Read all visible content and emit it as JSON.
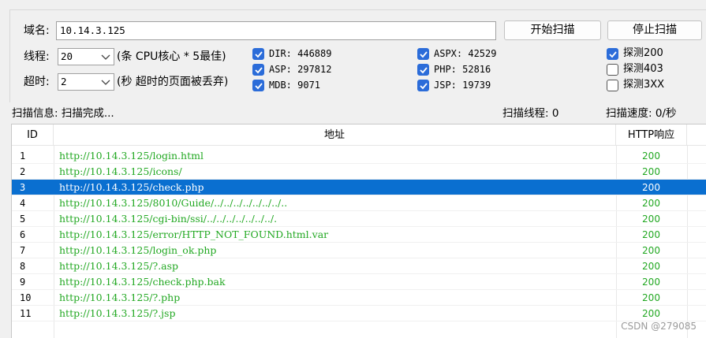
{
  "domain_field": {
    "label": "域名:",
    "value": "10.14.3.125"
  },
  "buttons": {
    "start": "开始扫描",
    "stop": "停止扫描"
  },
  "threads": {
    "label": "线程:",
    "value": "20",
    "hint": "(条 CPU核心 * 5最佳)"
  },
  "timeout": {
    "label": "超时:",
    "value": "2",
    "hint": "(秒 超时的页面被丢弃)"
  },
  "dicts": [
    {
      "label": "DIR: 446889",
      "checked": true
    },
    {
      "label": "ASP: 297812",
      "checked": true
    },
    {
      "label": "MDB: 9071",
      "checked": true
    },
    {
      "label": "ASPX: 42529",
      "checked": true
    },
    {
      "label": "PHP: 52816",
      "checked": true
    },
    {
      "label": "JSP: 19739",
      "checked": true
    }
  ],
  "probes": [
    {
      "label": "探测200",
      "checked": true
    },
    {
      "label": "探测403",
      "checked": false
    },
    {
      "label": "探测3XX",
      "checked": false
    }
  ],
  "status": {
    "info": "扫描信息: 扫描完成...",
    "threads": "扫描线程: 0",
    "speed": "扫描速度: 0/秒"
  },
  "table": {
    "headers": {
      "id": "ID",
      "address": "地址",
      "http": "HTTP响应"
    },
    "selected_index": 2,
    "rows": [
      {
        "id": "1",
        "url": "http://10.14.3.125/login.html",
        "code": "200"
      },
      {
        "id": "2",
        "url": "http://10.14.3.125/icons/",
        "code": "200"
      },
      {
        "id": "3",
        "url": "http://10.14.3.125/check.php",
        "code": "200"
      },
      {
        "id": "4",
        "url": "http://10.14.3.125/8010/Guide/../../../../../../../..",
        "code": "200"
      },
      {
        "id": "5",
        "url": "http://10.14.3.125/cgi-bin/ssi/../../../../../../../.",
        "code": "200"
      },
      {
        "id": "6",
        "url": "http://10.14.3.125/error/HTTP_NOT_FOUND.html.var",
        "code": "200"
      },
      {
        "id": "7",
        "url": "http://10.14.3.125/login_ok.php",
        "code": "200"
      },
      {
        "id": "8",
        "url": "http://10.14.3.125/?.asp",
        "code": "200"
      },
      {
        "id": "9",
        "url": "http://10.14.3.125/check.php.bak",
        "code": "200"
      },
      {
        "id": "10",
        "url": "http://10.14.3.125/?.php",
        "code": "200"
      },
      {
        "id": "11",
        "url": "http://10.14.3.125/?.jsp",
        "code": "200"
      }
    ]
  },
  "watermark": "CSDN @279085"
}
